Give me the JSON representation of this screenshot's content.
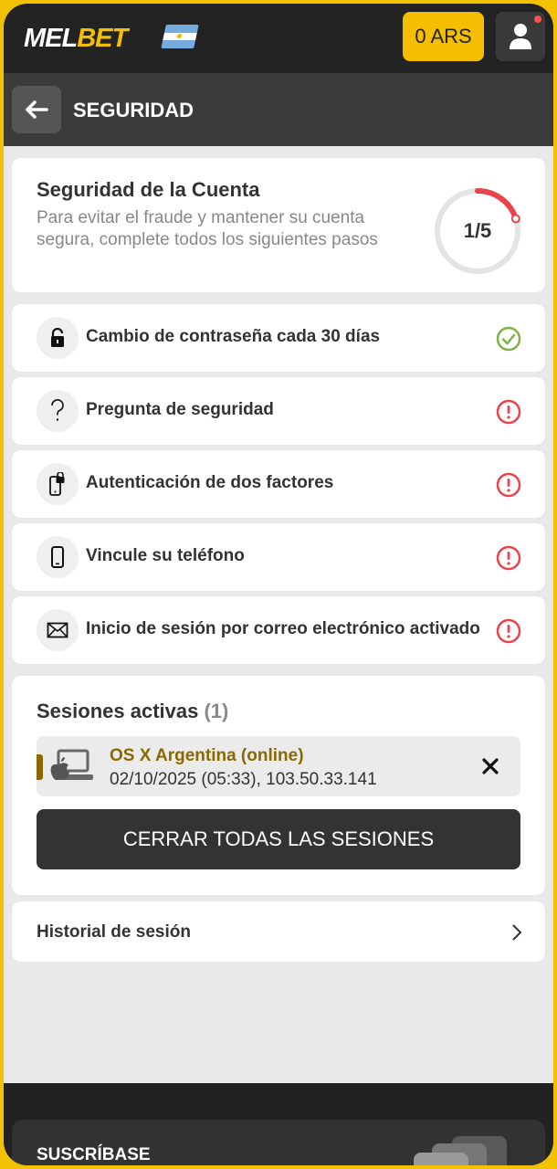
{
  "header": {
    "logo_part1": "MEL",
    "logo_part2": "BET",
    "flag_icon": "argentina-flag-icon",
    "balance": "0 ARS",
    "user_icon": "user-icon"
  },
  "subheader": {
    "back_icon": "arrow-left-icon",
    "title": "SEGURIDAD"
  },
  "security": {
    "title": "Seguridad de la Cuenta",
    "description": "Para evitar el fraude y mantener su cuenta segura, complete todos los siguientes pasos",
    "progress_text": "1/5",
    "progress_completed": 1,
    "progress_total": 5,
    "ring_color": "#e9434e"
  },
  "items": [
    {
      "label": "Cambio de contraseña cada 30 días",
      "icon": "lock-icon",
      "status": "done"
    },
    {
      "label": "Pregunta de seguridad",
      "icon": "question-icon",
      "status": "warning"
    },
    {
      "label": "Autenticación de dos factores",
      "icon": "phone-lock-icon",
      "status": "warning"
    },
    {
      "label": "Vincule su teléfono",
      "icon": "phone-icon",
      "status": "warning"
    },
    {
      "label": "Inicio de sesión por correo electrónico activado",
      "icon": "envelope-icon",
      "status": "warning"
    }
  ],
  "status_colors": {
    "done": "#7cb342",
    "warning": "#e9434e"
  },
  "sessions": {
    "title": "Sesiones activas",
    "count": "(1)",
    "list": [
      {
        "name": "OS X Argentina (online)",
        "info": "02/10/2025 (05:33), 103.50.33.141",
        "icon": "mac-laptop-icon"
      }
    ],
    "close_all_label": "CERRAR TODAS LAS SESIONES"
  },
  "history": {
    "label": "Historial de sesión"
  },
  "footer": {
    "subscribe_label": "SUSCRÍBASE"
  }
}
